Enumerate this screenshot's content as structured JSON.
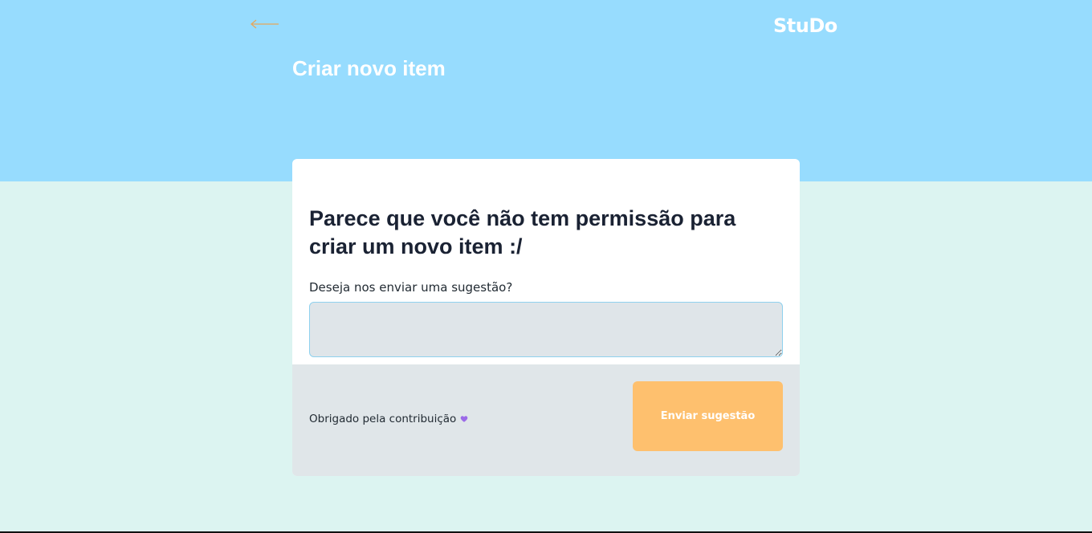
{
  "header": {
    "brand": "StuDo",
    "title": "Criar novo item",
    "back_icon": "arrow-left-icon"
  },
  "card": {
    "heading": "Parece que você não tem permissão para criar um novo item :/",
    "field_label": "Deseja nos enviar uma sugestão?",
    "field_value": "",
    "field_placeholder": ""
  },
  "footer": {
    "thanks_text": "Obrigado pela contribuição",
    "heart_icon": "heart-icon",
    "send_label": "Enviar sugestão"
  },
  "colors": {
    "header_bg": "#97dcfe",
    "page_bg": "#dcf4f1",
    "button_bg": "#fec06e",
    "heart": "#9b6ae8",
    "arrow": "#e6a75c"
  }
}
